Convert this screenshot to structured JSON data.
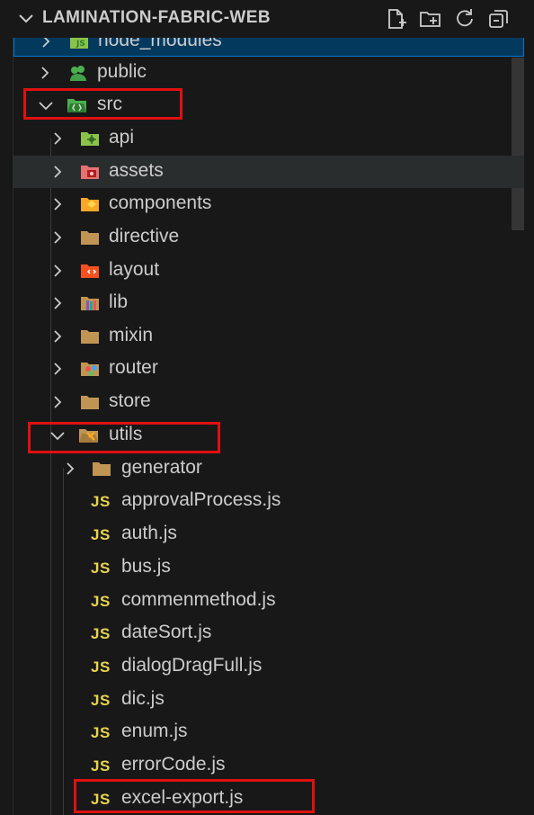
{
  "explorer": {
    "title": "LAMINATION-FABRIC-WEB",
    "actions": [
      "new-file-icon",
      "new-folder-icon",
      "refresh-icon",
      "collapse-all-icon"
    ]
  },
  "tree": {
    "node_modules": "node_modules",
    "public": "public",
    "src": "src",
    "api": "api",
    "assets": "assets",
    "components": "components",
    "directive": "directive",
    "layout": "layout",
    "lib": "lib",
    "mixin": "mixin",
    "router": "router",
    "store": "store",
    "utils": "utils",
    "generator": "generator",
    "files": [
      "approvalProcess.js",
      "auth.js",
      "bus.js",
      "commenmethod.js",
      "dateSort.js",
      "dialogDragFull.js",
      "dic.js",
      "enum.js",
      "errorCode.js",
      "excel-export.js"
    ],
    "js_badge": "JS"
  },
  "colors": {
    "background": "#181818",
    "selection": "#04395e",
    "highlight_box": "#e01010",
    "js_icon": "#e8d44d",
    "folder": "#c09553"
  }
}
